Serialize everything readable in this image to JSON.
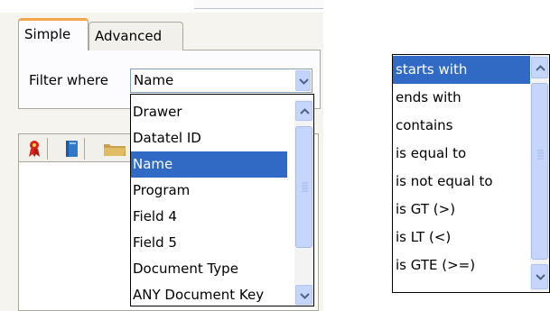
{
  "tabs": [
    {
      "label": "Simple",
      "active": true
    },
    {
      "label": "Advanced",
      "active": false
    }
  ],
  "filter": {
    "label": "Filter where",
    "selected_value": "Name"
  },
  "field_dropdown": {
    "items": [
      {
        "label": "Drawer",
        "selected": false
      },
      {
        "label": "Datatel ID",
        "selected": false
      },
      {
        "label": "Name",
        "selected": true
      },
      {
        "label": "Program",
        "selected": false
      },
      {
        "label": "Field 4",
        "selected": false
      },
      {
        "label": "Field 5",
        "selected": false
      },
      {
        "label": "Document Type",
        "selected": false
      },
      {
        "label": "ANY Document Key",
        "selected": false
      }
    ]
  },
  "toolbar": {
    "icons": [
      "ribbon-icon",
      "book-icon",
      "folder-icon"
    ]
  },
  "operator_list": {
    "items": [
      {
        "label": "starts with",
        "selected": true
      },
      {
        "label": "ends with",
        "selected": false
      },
      {
        "label": "contains",
        "selected": false
      },
      {
        "label": "is equal to",
        "selected": false
      },
      {
        "label": "is not equal to",
        "selected": false
      },
      {
        "label": "is GT (>)",
        "selected": false
      },
      {
        "label": "is LT (<)",
        "selected": false
      },
      {
        "label": "is GTE (>=)",
        "selected": false
      }
    ]
  },
  "colors": {
    "selection": "#316ac5",
    "tab_accent": "#f6a64a",
    "panel_bg": "#f5f4ee",
    "scroll_button": "#c5d5fc"
  }
}
